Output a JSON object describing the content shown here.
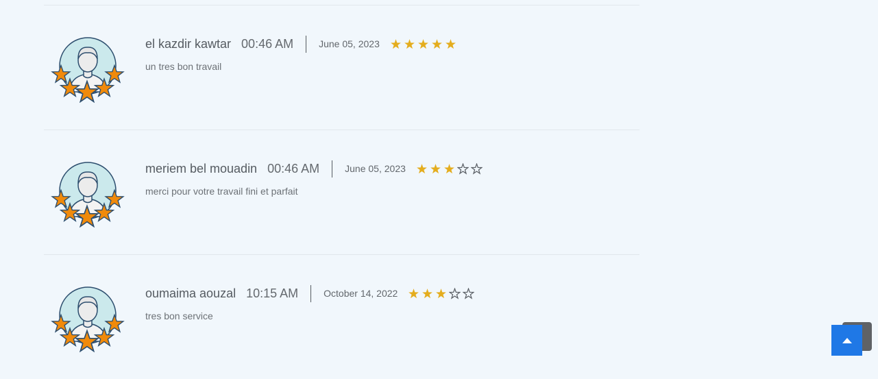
{
  "reviews": [
    {
      "name": "el kazdir kawtar",
      "time": "00:46 AM",
      "date": "June 05, 2023",
      "rating": 5,
      "text": "un tres bon travail"
    },
    {
      "name": "meriem bel mouadin",
      "time": "00:46 AM",
      "date": "June 05, 2023",
      "rating": 3,
      "text": "merci pour votre travail fini et parfait"
    },
    {
      "name": "oumaima aouzal",
      "time": "10:15 AM",
      "date": "October 14, 2022",
      "rating": 3,
      "text": "tres bon service"
    }
  ],
  "max_rating": 5,
  "colors": {
    "star_filled": "#e4ad1e",
    "star_empty_outline": "#5b6066",
    "avatar_star": "#f08a0b",
    "avatar_circle": "#cbe9ec",
    "scroll_button": "#1f78e6"
  },
  "icons": {
    "avatar": "user-avatar-with-stars-icon",
    "rating_star": "star-icon",
    "scroll_top": "arrow-up-icon"
  }
}
